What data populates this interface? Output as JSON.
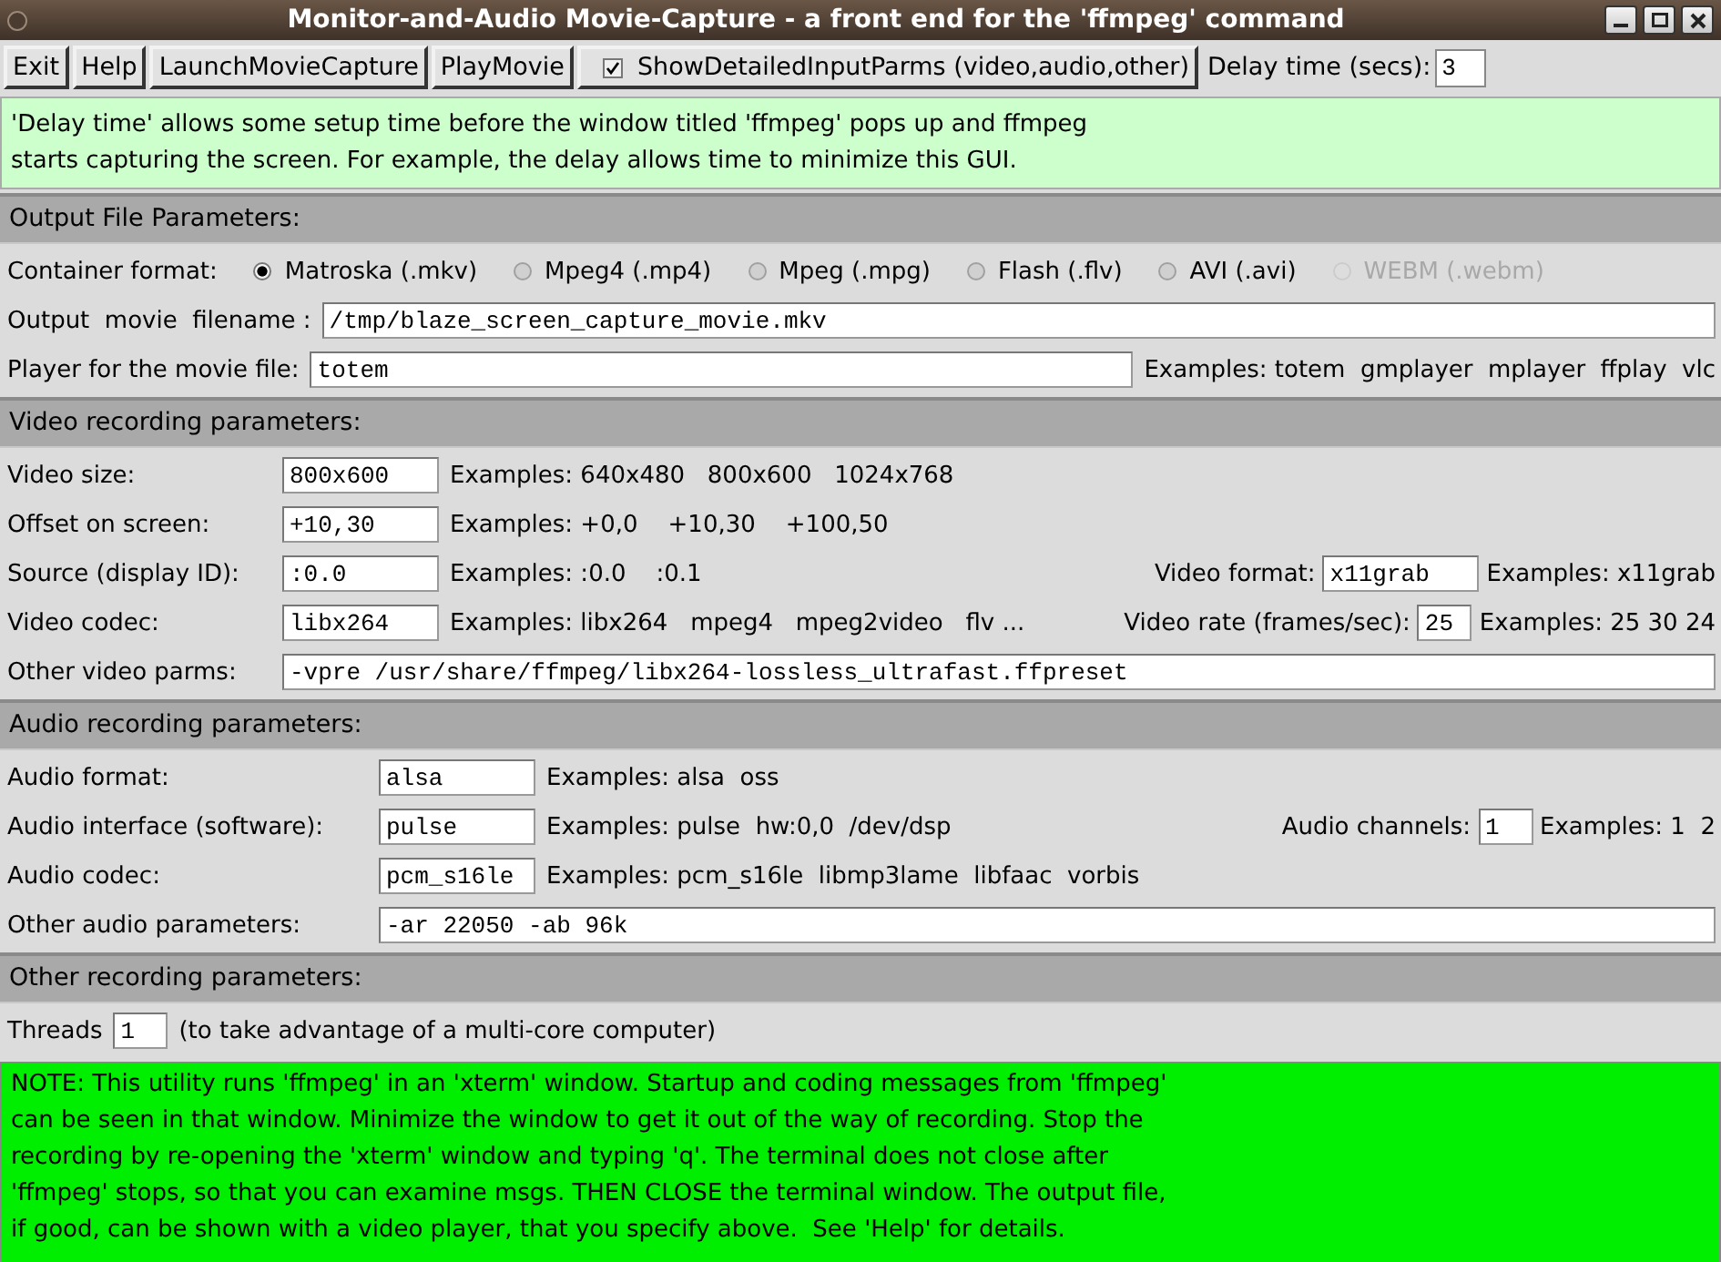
{
  "window": {
    "title": "Monitor-and-Audio Movie-Capture - a front end for the 'ffmpeg' command"
  },
  "toolbar": {
    "buttons": [
      "Exit",
      "Help",
      "LaunchMovieCapture",
      "PlayMovie"
    ],
    "checkbox": {
      "label": "ShowDetailedInputParms (video,audio,other)",
      "checked": true
    },
    "delay": {
      "label": "Delay time (secs):",
      "value": "3"
    }
  },
  "info": "'Delay time' allows some setup time before the window titled 'ffmpeg' pops up and ffmpeg\nstarts capturing the screen. For example, the delay allows time to minimize this GUI.",
  "sections": [
    {
      "header": "Output File Parameters:",
      "rows": [
        {
          "main": [
            {
              "kind": "label",
              "text": "Container format:"
            },
            {
              "kind": "radio",
              "text": "Matroska (.mkv)",
              "selected": true,
              "disabled": false
            },
            {
              "kind": "radio",
              "text": "Mpeg4 (.mp4)",
              "selected": false,
              "disabled": false
            },
            {
              "kind": "radio",
              "text": "Mpeg (.mpg)",
              "selected": false,
              "disabled": false
            },
            {
              "kind": "radio",
              "text": "Flash (.flv)",
              "selected": false,
              "disabled": false
            },
            {
              "kind": "radio",
              "text": "AVI (.avi)",
              "selected": false,
              "disabled": false
            },
            {
              "kind": "radio",
              "text": "WEBM (.webm)",
              "selected": false,
              "disabled": true
            }
          ]
        },
        {
          "main": [
            {
              "kind": "label",
              "text": "Output  movie  filename :"
            },
            {
              "kind": "field",
              "value": "/tmp/blaze_screen_capture_movie.mkv"
            }
          ]
        },
        {
          "main": [
            {
              "kind": "label",
              "text": "Player for the movie file:"
            },
            {
              "kind": "field",
              "value": "totem"
            }
          ],
          "side": [
            {
              "kind": "examples",
              "text": "Examples: totem  gmplayer  mplayer  ffplay  vlc"
            }
          ]
        }
      ]
    },
    {
      "header": "Video recording parameters:",
      "rows": [
        {
          "main": [
            {
              "kind": "label",
              "text": "Video size:"
            },
            {
              "kind": "field",
              "value": "800x600"
            },
            {
              "kind": "examples",
              "text": "Examples: 640x480   800x600   1024x768"
            }
          ]
        },
        {
          "main": [
            {
              "kind": "label",
              "text": "Offset on screen:"
            },
            {
              "kind": "field",
              "value": "+10,30"
            },
            {
              "kind": "examples",
              "text": "Examples: +0,0    +10,30    +100,50"
            }
          ]
        },
        {
          "main": [
            {
              "kind": "label",
              "text": "Source (display ID):"
            },
            {
              "kind": "field",
              "value": ":0.0"
            },
            {
              "kind": "examples",
              "text": "Examples: :0.0    :0.1"
            }
          ],
          "side": [
            {
              "kind": "label",
              "text": "Video format:"
            },
            {
              "kind": "field",
              "value": "x11grab"
            },
            {
              "kind": "examples",
              "text": "Examples: x11grab"
            }
          ]
        },
        {
          "main": [
            {
              "kind": "label",
              "text": "Video codec:"
            },
            {
              "kind": "field",
              "value": "libx264"
            },
            {
              "kind": "examples",
              "text": "Examples: libx264   mpeg4   mpeg2video   flv ..."
            }
          ],
          "side": [
            {
              "kind": "label",
              "text": "Video rate (frames/sec):"
            },
            {
              "kind": "field",
              "value": "25"
            },
            {
              "kind": "examples",
              "text": "Examples: 25 30 24"
            }
          ]
        },
        {
          "main": [
            {
              "kind": "label",
              "text": "Other video parms:"
            },
            {
              "kind": "field",
              "value": "-vpre /usr/share/ffmpeg/libx264-lossless_ultrafast.ffpreset"
            }
          ]
        }
      ]
    },
    {
      "header": "Audio recording parameters:",
      "rows": [
        {
          "main": [
            {
              "kind": "label",
              "text": "Audio format:"
            },
            {
              "kind": "field",
              "value": "alsa"
            },
            {
              "kind": "examples",
              "text": "Examples: alsa  oss"
            }
          ]
        },
        {
          "main": [
            {
              "kind": "label",
              "text": "Audio interface (software):"
            },
            {
              "kind": "field",
              "value": "pulse"
            },
            {
              "kind": "examples",
              "text": "Examples: pulse  hw:0,0  /dev/dsp"
            }
          ],
          "side": [
            {
              "kind": "label",
              "text": "Audio channels:"
            },
            {
              "kind": "field",
              "value": "1"
            },
            {
              "kind": "examples",
              "text": "Examples: 1  2"
            }
          ]
        },
        {
          "main": [
            {
              "kind": "label",
              "text": "Audio codec:"
            },
            {
              "kind": "field",
              "value": "pcm_s16le"
            },
            {
              "kind": "examples",
              "text": "Examples: pcm_s16le  libmp3lame  libfaac  vorbis"
            }
          ]
        },
        {
          "main": [
            {
              "kind": "label",
              "text": "Other audio parameters:"
            },
            {
              "kind": "field",
              "value": "-ar 22050 -ab 96k"
            }
          ]
        }
      ]
    },
    {
      "header": "Other recording parameters:",
      "rows": [
        {
          "main": [
            {
              "kind": "label",
              "text": "Threads"
            },
            {
              "kind": "field",
              "value": "1"
            },
            {
              "kind": "examples",
              "text": "(to take advantage of a multi-core computer)"
            }
          ]
        }
      ]
    }
  ],
  "note": "NOTE: This utility runs 'ffmpeg' in an 'xterm' window. Startup and coding messages from 'ffmpeg'\ncan be seen in that window. Minimize the window to get it out of the way of recording. Stop the\nrecording by re-opening the 'xterm' window and typing 'q'. The terminal does not close after\n'ffmpeg' stops, so that you can examine msgs. THEN CLOSE the terminal window. The output file,\nif good, can be shown with a video player, that you specify above.  See 'Help' for details."
}
